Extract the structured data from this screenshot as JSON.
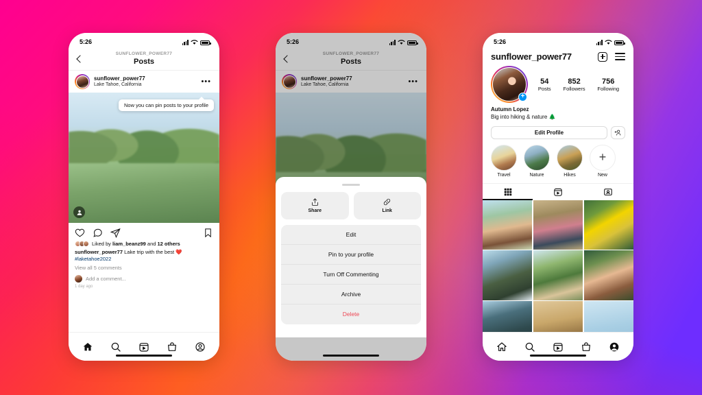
{
  "background": {
    "colors": [
      "#ff0090",
      "#fb5b22",
      "#ffd000",
      "#8c28fa",
      "#6e2dff"
    ]
  },
  "phone1": {
    "status": {
      "time": "5:26",
      "icons": [
        "signal-icon",
        "wifi-icon",
        "battery-icon"
      ]
    },
    "nav": {
      "back_icon": "chevron-left-icon",
      "subtitle": "SUNFLOWER_POWER77",
      "title": "Posts"
    },
    "post": {
      "author": "sunflower_power77",
      "location": "Lake Tahoe, California",
      "more_icon": "more-options-icon",
      "tag_icon": "person-tag-icon",
      "tooltip": "Now you can pin posts to your profile",
      "actions": [
        "like-icon",
        "comment-icon",
        "share-icon",
        "bookmark-icon"
      ],
      "liked_prefix": "Liked by ",
      "liked_user": "liam_beanz99",
      "liked_mid": " and ",
      "liked_count": "12 others",
      "caption_user": "sunflower_power77",
      "caption_text": " Lake trip with the best ❤️",
      "caption_hashtag": "#laketahoe2022",
      "view_comments": "View all 5 comments",
      "add_comment_placeholder": "Add a comment...",
      "timestamp": "1 day ago"
    },
    "tabbar": [
      "home-icon",
      "search-icon",
      "reels-icon",
      "shop-icon",
      "profile-icon"
    ]
  },
  "phone2": {
    "status": {
      "time": "5:26"
    },
    "nav": {
      "subtitle": "SUNFLOWER_POWER77",
      "title": "Posts"
    },
    "post": {
      "author": "sunflower_power77",
      "location": "Lake Tahoe, California"
    },
    "sheet": {
      "grabber": "drag-handle",
      "cards": [
        {
          "label": "Share",
          "icon": "share-up-icon"
        },
        {
          "label": "Link",
          "icon": "link-icon"
        }
      ],
      "items": [
        {
          "label": "Edit",
          "danger": false
        },
        {
          "label": "Pin to your profile",
          "danger": false
        },
        {
          "label": "Turn Off Commenting",
          "danger": false
        },
        {
          "label": "Archive",
          "danger": false
        },
        {
          "label": "Delete",
          "danger": true
        }
      ],
      "danger_color": "#ed4956"
    }
  },
  "phone3": {
    "status": {
      "time": "5:26"
    },
    "header": {
      "username": "sunflower_power77",
      "add_icon": "add-post-icon",
      "menu_icon": "hamburger-menu-icon"
    },
    "stats": [
      {
        "num": "54",
        "label": "Posts"
      },
      {
        "num": "852",
        "label": "Followers"
      },
      {
        "num": "756",
        "label": "Following"
      }
    ],
    "avatar_badge": "+",
    "bio": {
      "name": "Autumn Lopez",
      "text": "Big into hiking & nature 🌲"
    },
    "buttons": {
      "edit_profile": "Edit Profile",
      "add_person_icon": "add-person-icon"
    },
    "highlights": [
      {
        "label": "Travel"
      },
      {
        "label": "Nature"
      },
      {
        "label": "Hikes"
      },
      {
        "label": "New"
      }
    ],
    "tabs": [
      {
        "icon": "grid-icon",
        "active": true
      },
      {
        "icon": "reels-icon",
        "active": false
      },
      {
        "icon": "tagged-icon",
        "active": false
      }
    ],
    "tabbar": [
      "home-icon",
      "search-icon",
      "reels-icon",
      "shop-icon",
      "profile-icon-filled"
    ]
  }
}
